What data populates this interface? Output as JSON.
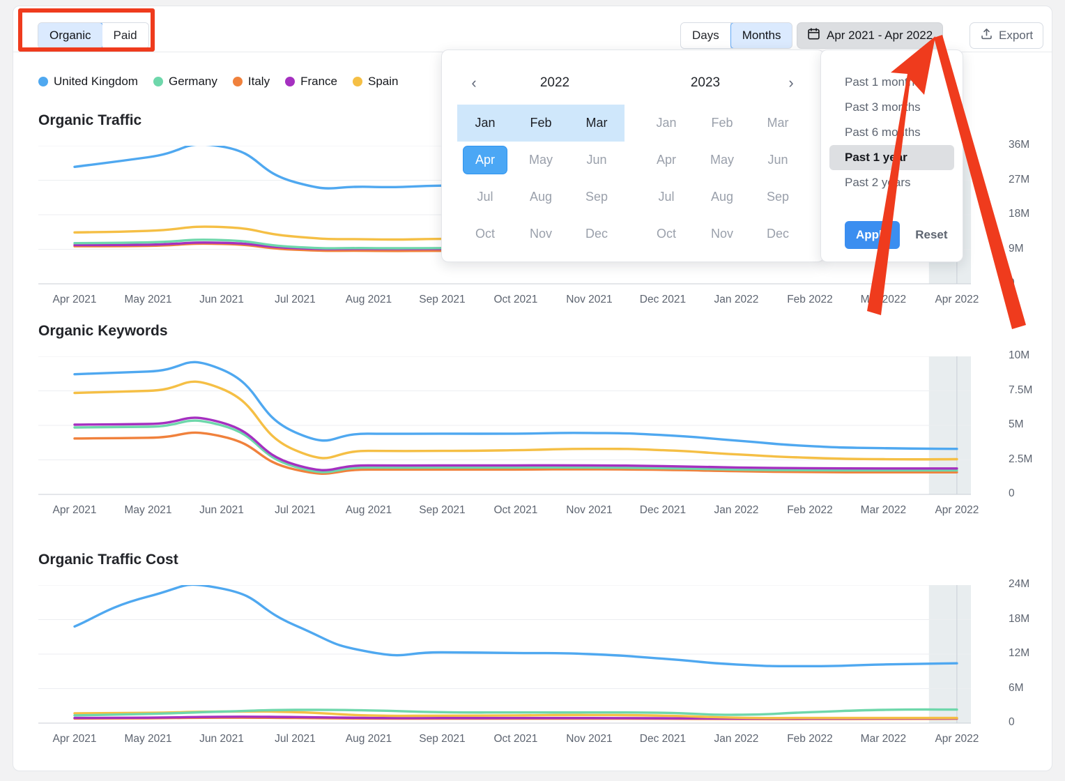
{
  "toolbar": {
    "mode_toggle": {
      "options": [
        "Organic",
        "Paid"
      ],
      "selected": "Organic"
    },
    "granularity_toggle": {
      "options": [
        "Days",
        "Months"
      ],
      "selected": "Months"
    },
    "date_range_label": "Apr 2021 - Apr 2022",
    "calendar_icon": "calendar-icon",
    "export_label": "Export",
    "export_icon": "upload-icon"
  },
  "legend": {
    "items": [
      {
        "label": "United Kingdom",
        "color": "#4fa8f0"
      },
      {
        "label": "Germany",
        "color": "#6ed7ab"
      },
      {
        "label": "Italy",
        "color": "#f0813c"
      },
      {
        "label": "France",
        "color": "#a530c0"
      },
      {
        "label": "Spain",
        "color": "#f5bf45"
      }
    ]
  },
  "date_picker": {
    "prev_icon": "chevron-left-icon",
    "next_icon": "chevron-right-icon",
    "left_year": "2022",
    "right_year": "2023",
    "months": [
      "Jan",
      "Feb",
      "Mar",
      "Apr",
      "May",
      "Jun",
      "Jul",
      "Aug",
      "Sep",
      "Oct",
      "Nov",
      "Dec"
    ],
    "left_in_range": [
      "Jan",
      "Feb",
      "Mar"
    ],
    "left_selected": [
      "Apr"
    ],
    "right_in_range": [],
    "right_selected": []
  },
  "presets": {
    "items": [
      "Past 1 month",
      "Past 3 months",
      "Past 6 months",
      "Past 1 year",
      "Past 2 years"
    ],
    "selected": "Past 1 year",
    "apply_label": "Apply",
    "reset_label": "Reset"
  },
  "annotations": {
    "highlight_box_target": "Organic / Paid toggle",
    "arrow_target": "date range button",
    "color": "#ef3b1d"
  },
  "chart_data": [
    {
      "type": "line",
      "title": "Organic Traffic",
      "xlabel": "",
      "ylabel": "",
      "grid": true,
      "legend_position": "top",
      "ylim": [
        0,
        36000000
      ],
      "yticks": [
        0,
        9000000,
        18000000,
        27000000,
        36000000
      ],
      "ytick_labels": [
        "0",
        "9M",
        "18M",
        "27M",
        "36M"
      ],
      "categories": [
        "Apr 2021",
        "May 2021",
        "Jun 2021",
        "Jul 2021",
        "Aug 2021",
        "Sep 2021",
        "Oct 2021",
        "Nov 2021",
        "Dec 2021",
        "Jan 2022",
        "Feb 2022",
        "Mar 2022",
        "Apr 2022"
      ],
      "series": [
        {
          "name": "United Kingdom",
          "color": "#4fa8f0",
          "values": [
            30500000,
            33000000,
            35800000,
            26500000,
            25300000,
            25600000,
            26000000,
            26100000,
            26000000,
            26000000,
            26000000,
            26000000,
            26000000
          ]
        },
        {
          "name": "Spain",
          "color": "#f5bf45",
          "values": [
            13400000,
            13800000,
            14800000,
            12300000,
            11600000,
            11700000,
            11900000,
            11900000,
            11800000,
            11800000,
            11800000,
            11700000,
            11700000
          ]
        },
        {
          "name": "Germany",
          "color": "#6ed7ab",
          "values": [
            10600000,
            10800000,
            11400000,
            9600000,
            9300000,
            9300000,
            9300000,
            9300000,
            9200000,
            9200000,
            9200000,
            9200000,
            9200000
          ]
        },
        {
          "name": "France",
          "color": "#a530c0",
          "values": [
            10100000,
            10200000,
            10700000,
            9300000,
            9100000,
            9100000,
            9100000,
            9100000,
            9000000,
            9000000,
            9000000,
            9000000,
            9000000
          ]
        },
        {
          "name": "Italy",
          "color": "#f0813c",
          "values": [
            9800000,
            9900000,
            10400000,
            8900000,
            8600000,
            8600000,
            8600000,
            8600000,
            8500000,
            8500000,
            8500000,
            8500000,
            8500000
          ]
        }
      ]
    },
    {
      "type": "line",
      "title": "Organic Keywords",
      "xlabel": "",
      "ylabel": "",
      "grid": true,
      "legend_position": "top",
      "ylim": [
        0,
        10000000
      ],
      "yticks": [
        0,
        2500000,
        5000000,
        7500000,
        10000000
      ],
      "ytick_labels": [
        "0",
        "2.5M",
        "5M",
        "7.5M",
        "10M"
      ],
      "categories": [
        "Apr 2021",
        "May 2021",
        "Jun 2021",
        "Jul 2021",
        "Aug 2021",
        "Sep 2021",
        "Oct 2021",
        "Nov 2021",
        "Dec 2021",
        "Jan 2022",
        "Feb 2022",
        "Mar 2022",
        "Apr 2022"
      ],
      "series": [
        {
          "name": "United Kingdom",
          "color": "#4fa8f0",
          "values": [
            8700000,
            8900000,
            9050000,
            4500000,
            4400000,
            4400000,
            4400000,
            4450000,
            4300000,
            3900000,
            3500000,
            3350000,
            3300000
          ]
        },
        {
          "name": "Spain",
          "color": "#f5bf45",
          "values": [
            7350000,
            7500000,
            7650000,
            3200000,
            3150000,
            3150000,
            3200000,
            3300000,
            3200000,
            2900000,
            2650000,
            2550000,
            2550000
          ]
        },
        {
          "name": "France",
          "color": "#a530c0",
          "values": [
            5050000,
            5100000,
            5200000,
            2150000,
            2100000,
            2100000,
            2100000,
            2100000,
            2050000,
            1950000,
            1900000,
            1880000,
            1880000
          ]
        },
        {
          "name": "Germany",
          "color": "#6ed7ab",
          "values": [
            4850000,
            4900000,
            5000000,
            2000000,
            1950000,
            1950000,
            1950000,
            1950000,
            1900000,
            1800000,
            1750000,
            1740000,
            1740000
          ]
        },
        {
          "name": "Italy",
          "color": "#f0813c",
          "values": [
            4050000,
            4100000,
            4200000,
            1800000,
            1800000,
            1800000,
            1800000,
            1820000,
            1780000,
            1680000,
            1620000,
            1600000,
            1600000
          ]
        }
      ]
    },
    {
      "type": "line",
      "title": "Organic Traffic Cost",
      "xlabel": "",
      "ylabel": "",
      "grid": true,
      "legend_position": "top",
      "ylim": [
        0,
        24000000
      ],
      "yticks": [
        0,
        6000000,
        12000000,
        18000000,
        24000000
      ],
      "ytick_labels": [
        "0",
        "6M",
        "12M",
        "18M",
        "24M"
      ],
      "categories": [
        "Apr 2021",
        "May 2021",
        "Jun 2021",
        "Jul 2021",
        "Aug 2021",
        "Sep 2021",
        "Oct 2021",
        "Nov 2021",
        "Dec 2021",
        "Jan 2022",
        "Feb 2022",
        "Mar 2022",
        "Apr 2022"
      ],
      "series": [
        {
          "name": "United Kingdom",
          "color": "#4fa8f0",
          "values": [
            16800000,
            22000000,
            23400000,
            17000000,
            12400000,
            12300000,
            12200000,
            12000000,
            11200000,
            10200000,
            9900000,
            10200000,
            10400000
          ]
        },
        {
          "name": "Germany",
          "color": "#6ed7ab",
          "values": [
            1350000,
            1600000,
            2000000,
            2300000,
            2200000,
            1900000,
            1850000,
            1850000,
            1800000,
            1450000,
            1900000,
            2300000,
            2350000
          ]
        },
        {
          "name": "Spain",
          "color": "#f5bf45",
          "values": [
            1700000,
            1800000,
            2000000,
            1900000,
            1350000,
            1300000,
            1350000,
            1400000,
            1300000,
            950000,
            900000,
            900000,
            900000
          ]
        },
        {
          "name": "France",
          "color": "#a530c0",
          "values": [
            900000,
            950000,
            1100000,
            1050000,
            900000,
            880000,
            880000,
            880000,
            850000,
            800000,
            800000,
            820000,
            850000
          ]
        },
        {
          "name": "Italy",
          "color": "#f0813c",
          "values": [
            800000,
            850000,
            950000,
            900000,
            800000,
            780000,
            780000,
            780000,
            760000,
            720000,
            720000,
            740000,
            760000
          ]
        }
      ]
    }
  ]
}
